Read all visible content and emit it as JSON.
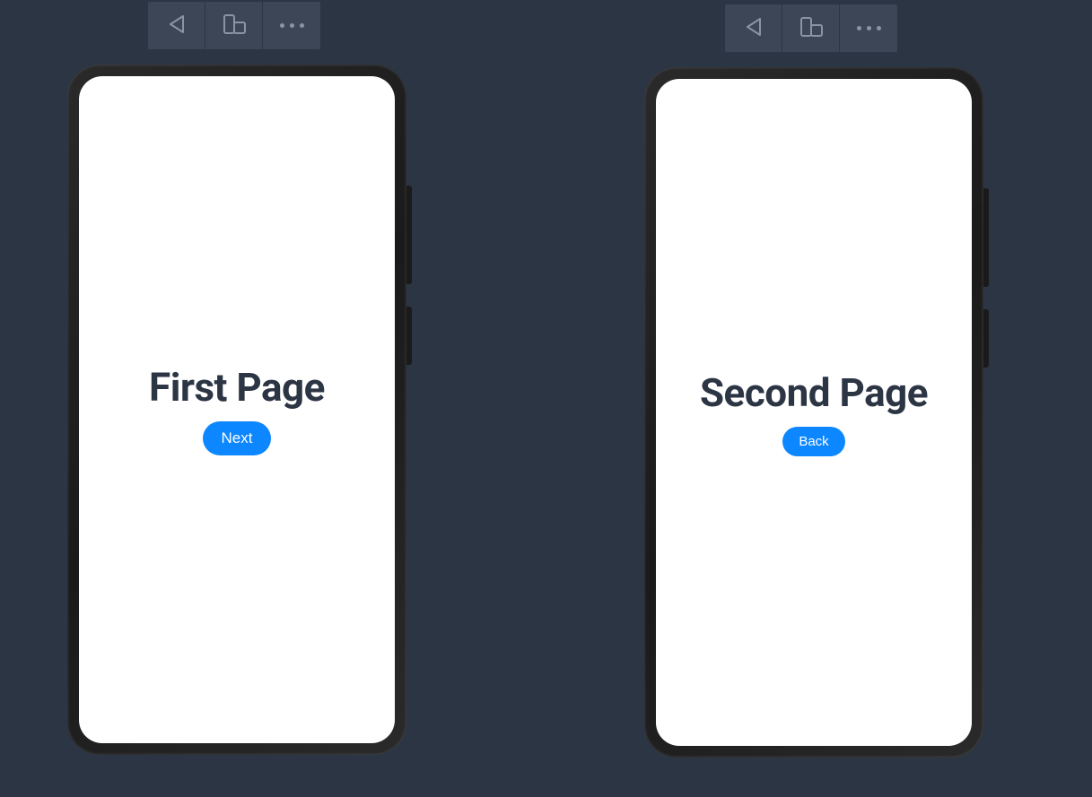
{
  "previews": [
    {
      "toolbar": {
        "back_icon": "back-triangle-icon",
        "device_icon": "device-icon",
        "menu_icon": "more-dots-icon"
      },
      "page": {
        "title": "First Page",
        "button_label": "Next"
      }
    },
    {
      "toolbar": {
        "back_icon": "back-triangle-icon",
        "device_icon": "device-icon",
        "menu_icon": "more-dots-icon"
      },
      "page": {
        "title": "Second Page",
        "button_label": "Back"
      }
    }
  ]
}
